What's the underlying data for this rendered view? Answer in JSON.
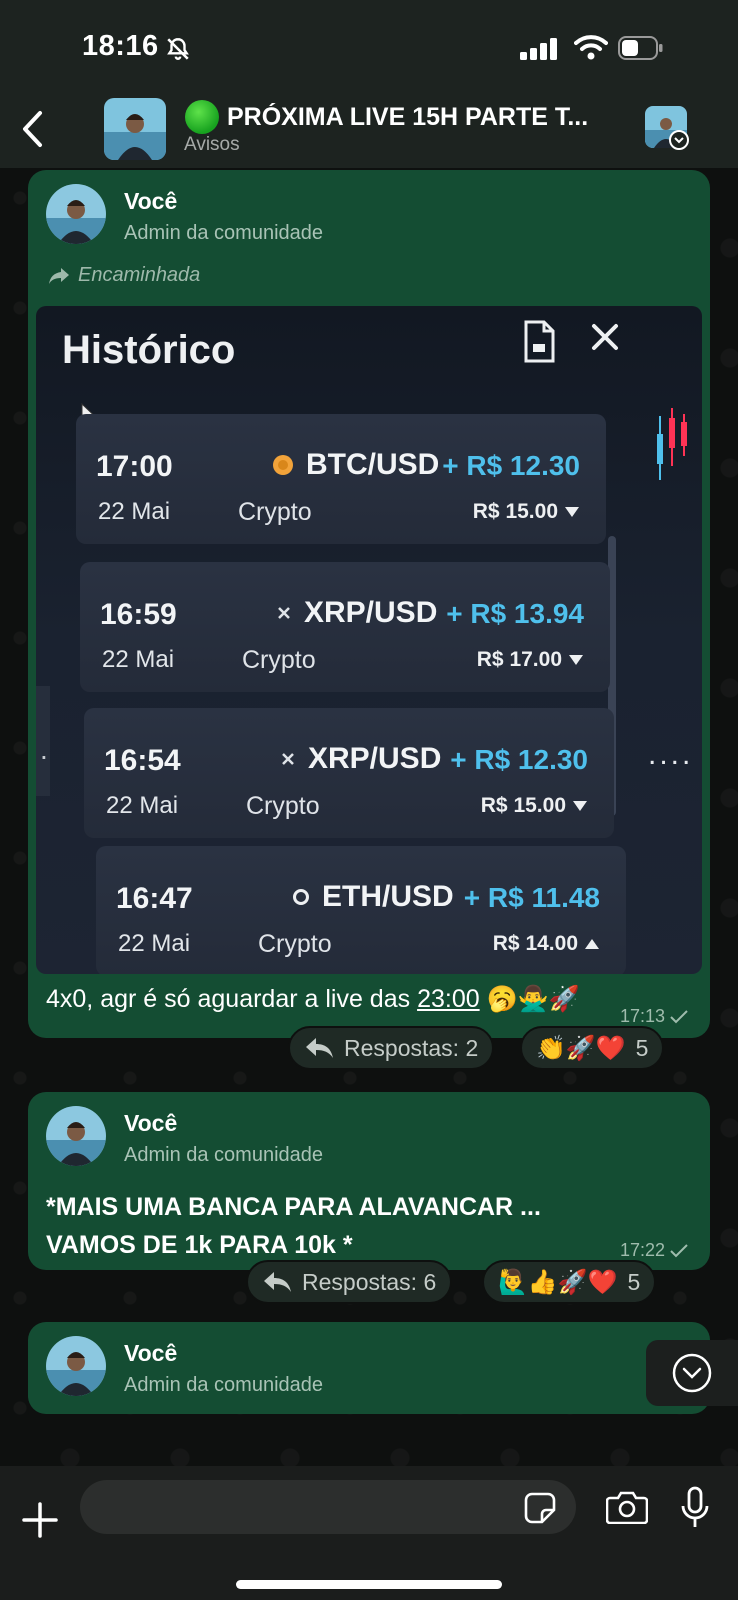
{
  "status_bar": {
    "time": "18:16",
    "icons": [
      "bell-slash-icon",
      "signal-icon",
      "wifi-icon",
      "battery-icon"
    ]
  },
  "header": {
    "status_emoji_color": "#22b02a",
    "title": "PRÓXIMA LIVE 15H PARTE T...",
    "subtitle": "Avisos"
  },
  "messages": [
    {
      "sender": "Você",
      "role": "Admin da comunidade",
      "forwarded_label": "Encaminhada",
      "image": {
        "title": "Histórico",
        "trades": [
          {
            "time": "17:00",
            "date": "22 Mai",
            "pair": "BTC/USD",
            "category": "Crypto",
            "profit": "+ R$ 12.30",
            "stake": "R$ 15.00",
            "direction": "down",
            "coin": "btc"
          },
          {
            "time": "16:59",
            "date": "22 Mai",
            "pair": "XRP/USD",
            "category": "Crypto",
            "profit": "+ R$ 13.94",
            "stake": "R$ 17.00",
            "direction": "down",
            "coin": "xrp"
          },
          {
            "time": "16:54",
            "date": "22 Mai",
            "pair": "XRP/USD",
            "category": "Crypto",
            "profit": "+ R$ 12.30",
            "stake": "R$ 15.00",
            "direction": "down",
            "coin": "xrp"
          },
          {
            "time": "16:47",
            "date": "22 Mai",
            "pair": "ETH/USD",
            "category": "Crypto",
            "profit": "+ R$ 11.48",
            "stake": "R$ 14.00",
            "direction": "up",
            "coin": "eth"
          }
        ],
        "more_indicator": "....",
        "left_indicator": "."
      },
      "text_before_link": "4x0, agr é só aguardar a live das ",
      "text_link": "23:00",
      "text_emojis": "🥱🙅‍♂️🚀",
      "time": "17:13",
      "replies_label": "Respostas: 2",
      "reactions": "👏🚀❤️",
      "reactions_count": "5"
    },
    {
      "sender": "Você",
      "role": "Admin da comunidade",
      "text_line1": "*MAIS UMA BANCA PARA ALAVANCAR ...",
      "text_line2": "VAMOS DE 1k PARA 10k *",
      "time": "17:22",
      "replies_label": "Respostas: 6",
      "reactions": "🙋‍♂️👍🚀❤️",
      "reactions_count": "5"
    },
    {
      "sender": "Você",
      "role": "Admin da comunidade"
    }
  ],
  "composer": {
    "placeholder": "",
    "icons": [
      "plus-icon",
      "sticker-icon",
      "camera-icon",
      "microphone-icon"
    ]
  },
  "colors": {
    "bubble": "#144d33",
    "header": "#1d2320",
    "profit": "#4fc0ec"
  }
}
